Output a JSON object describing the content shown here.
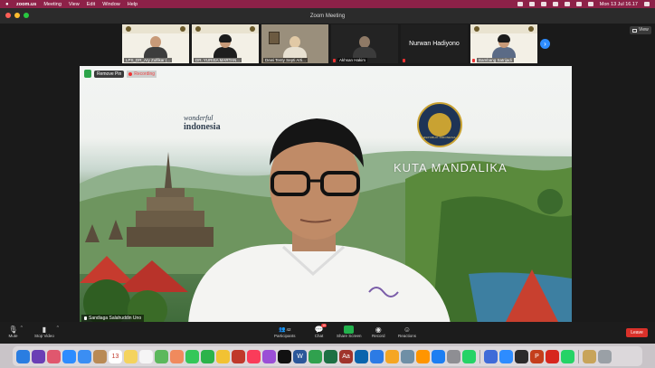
{
  "menubar": {
    "app_name": "zoom.us",
    "items": [
      "Meeting",
      "View",
      "Edit",
      "Window",
      "Help"
    ],
    "clock": "Mon 13 Jul 16.17"
  },
  "window": {
    "title": "Zoom Meeting"
  },
  "gallery": {
    "tiles": [
      {
        "name": "LPS_DR_Ary Zulfikar (...",
        "kind": "slide"
      },
      {
        "name": "DR. YURISA  MARTAN...",
        "kind": "slide-person"
      },
      {
        "name": "Dewi Tenty Septi Arti...",
        "kind": "room"
      },
      {
        "name": "Akhsan Hakim",
        "kind": "dark"
      },
      {
        "name": "Nurwan Hadiyono",
        "kind": "nameonly"
      },
      {
        "name": "Bambang Satrijadi",
        "kind": "slide-person"
      }
    ],
    "next_label": "›"
  },
  "view_button": {
    "label": "View"
  },
  "main_video": {
    "remove_pin_label": "Remove Pin",
    "recording_label": "Recording",
    "brand_line1": "wonderful",
    "brand_line2": "indonesia",
    "emblem_text": "REPUBLIK INDONESIA",
    "location_text": "KUTA   MANDALIKA",
    "speaker_name": "Sandiaga Salahuddin Uno"
  },
  "toolbar": {
    "mute_label": "Mute",
    "stop_video_label": "Stop Video",
    "participants_label": "Participants",
    "participants_count": "42",
    "chat_label": "Chat",
    "chat_badge": "10",
    "share_label": "Share Screen",
    "record_label": "Record",
    "reactions_label": "Reactions",
    "leave_label": "Leave"
  },
  "dock": {
    "apps": [
      {
        "name": "finder-icon",
        "color": "#2a7de1"
      },
      {
        "name": "siri-icon",
        "color": "#6a3fb5"
      },
      {
        "name": "launchpad-icon",
        "color": "#e0576e"
      },
      {
        "name": "safari-icon",
        "color": "#2d8cff"
      },
      {
        "name": "mail-icon",
        "color": "#3b8ef3"
      },
      {
        "name": "contacts-icon",
        "color": "#b98a55"
      },
      {
        "name": "calendar-icon",
        "color": "#ffffff",
        "text": "13"
      },
      {
        "name": "notes-icon",
        "color": "#f4d35e"
      },
      {
        "name": "reminders-icon",
        "color": "#f5f5f5"
      },
      {
        "name": "maps-icon",
        "color": "#5cb85c"
      },
      {
        "name": "photos-icon",
        "color": "#f08a5d"
      },
      {
        "name": "messages-icon",
        "color": "#34c759"
      },
      {
        "name": "facetime-icon",
        "color": "#2bb34a"
      },
      {
        "name": "chrome-icon",
        "color": "#f2c233"
      },
      {
        "name": "photo-booth-icon",
        "color": "#c0392b"
      },
      {
        "name": "music-icon",
        "color": "#fa3c5a"
      },
      {
        "name": "podcasts-icon",
        "color": "#9b4fd6"
      },
      {
        "name": "tv-icon",
        "color": "#111111"
      },
      {
        "name": "word-icon",
        "color": "#2b579a",
        "text": "W"
      },
      {
        "name": "numbers-icon",
        "color": "#30a14e"
      },
      {
        "name": "excel-icon",
        "color": "#1d7044"
      },
      {
        "name": "dictionary-icon",
        "color": "#a0342c",
        "text": "Aa"
      },
      {
        "name": "outlook-icon",
        "color": "#0a64ad"
      },
      {
        "name": "keynote-icon",
        "color": "#2c7be5"
      },
      {
        "name": "pages-icon",
        "color": "#f5a623"
      },
      {
        "name": "preview-icon",
        "color": "#6f8fa6"
      },
      {
        "name": "books-icon",
        "color": "#ff9500"
      },
      {
        "name": "app-store-icon",
        "color": "#1c7ef2"
      },
      {
        "name": "system-preferences-icon",
        "color": "#8e8e93"
      },
      {
        "name": "whatsapp-icon",
        "color": "#25d366"
      },
      {
        "name": "vpn-icon",
        "color": "#3f6bd8"
      },
      {
        "name": "zoom-icon",
        "color": "#2d8cff"
      },
      {
        "name": "quicktime-icon",
        "color": "#2b2b2b"
      },
      {
        "name": "powerpoint-icon",
        "color": "#c43e1c",
        "text": "P"
      },
      {
        "name": "acrobat-icon",
        "color": "#d7261e"
      },
      {
        "name": "whatsapp-desktop-icon",
        "color": "#25d366"
      },
      {
        "name": "archive-icon",
        "color": "#c8a45a"
      },
      {
        "name": "trash-icon",
        "color": "#9aa0a6"
      }
    ]
  },
  "colors": {
    "menubar_bg": "#8d2148",
    "zoom_blue": "#2d8cff",
    "leave_red": "#d9312a",
    "share_green": "#22b14c"
  }
}
